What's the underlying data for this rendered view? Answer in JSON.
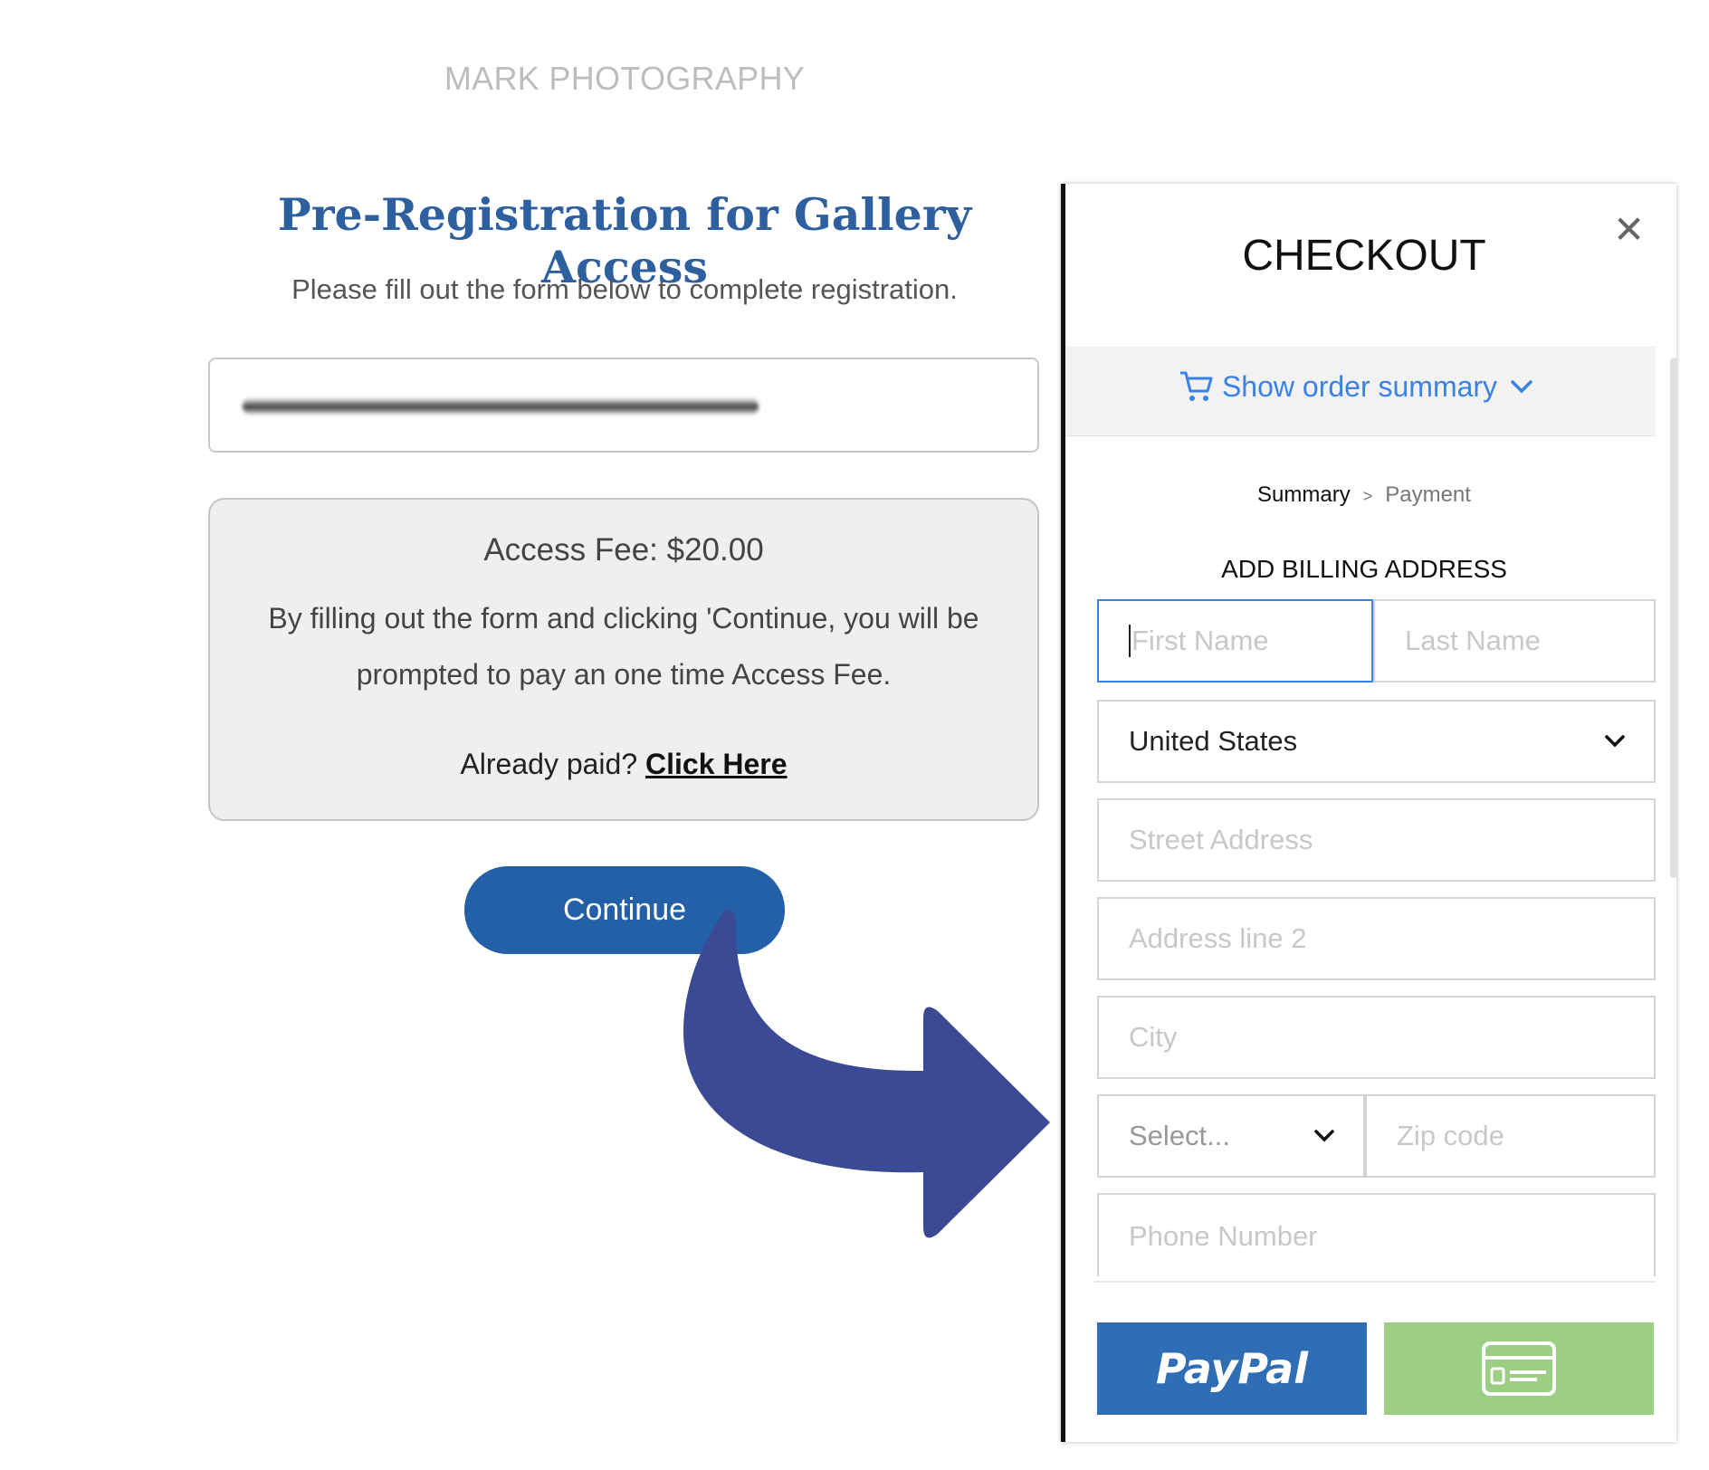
{
  "brand": "MARK PHOTOGRAPHY",
  "form": {
    "title": "Pre-Registration for Gallery Access",
    "subtitle": "Please fill out the form below to complete registration.",
    "fee_title": "Access Fee: $20.00",
    "fee_description": "By filling out the form and clicking 'Continue, you will be prompted to pay an one time Access Fee.",
    "already_paid": "Already paid?",
    "click_here": "Click Here",
    "continue_label": "Continue"
  },
  "checkout": {
    "title": "CHECKOUT",
    "close_glyph": "✕",
    "show_order_summary": "Show order summary",
    "breadcrumb": {
      "step1": "Summary",
      "separator": ">",
      "step2": "Payment"
    },
    "billing_heading": "ADD BILLING ADDRESS",
    "first_name_placeholder": "First Name",
    "last_name_placeholder": "Last Name",
    "country_value": "United States",
    "street_placeholder": "Street Address",
    "address2_placeholder": "Address line 2",
    "city_placeholder": "City",
    "state_value": "Select...",
    "zip_placeholder": "Zip code",
    "phone_placeholder": "Phone Number",
    "paypal_label": "PayPal"
  },
  "colors": {
    "brand_blue": "#2e5f9e",
    "button_blue": "#2460a7",
    "arrow": "#3a4a94",
    "paypal": "#2f6db5",
    "card_green": "#9ccf84",
    "link_blue": "#3b82e6"
  },
  "icons": [
    "cart-icon",
    "chevron-down-icon",
    "close-icon",
    "credit-card-icon",
    "arrow-right-icon"
  ]
}
